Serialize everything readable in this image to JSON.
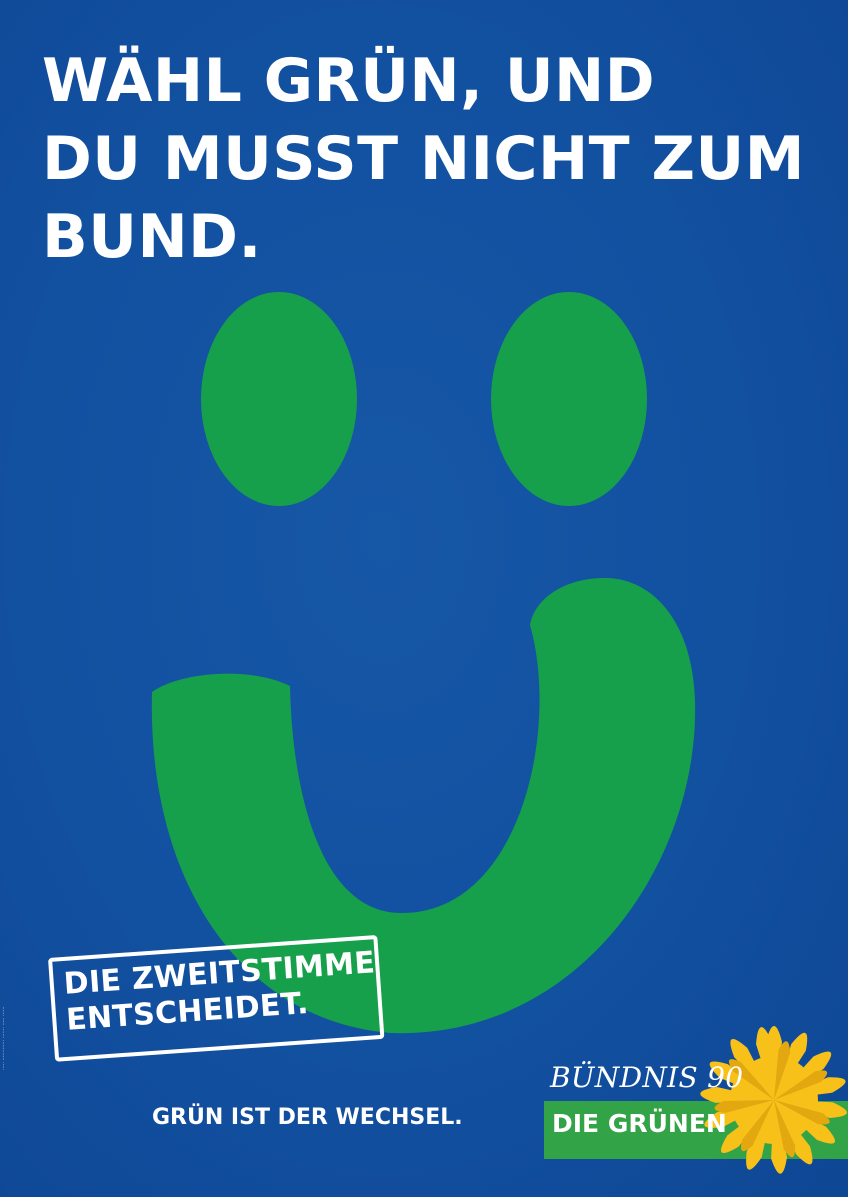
{
  "headline": {
    "line1": "WÄHL GRÜN, UND",
    "line2": "DU MUSST NICHT ZUM",
    "line3": "BUND."
  },
  "stamp": {
    "line1": "DIE ZWEITSTIMME",
    "line2": "ENTSCHEIDET."
  },
  "slogan": "GRÜN IST DER WECHSEL.",
  "logo": {
    "line1": "BÜNDNIS 90",
    "line2": "DIE GRÜNEN",
    "icon": "sunflower-icon"
  },
  "colors": {
    "background": "#1250a0",
    "smiley_green": "#16a04b",
    "logo_green": "#33a348",
    "sunflower_yellow": "#f7c11a",
    "text": "#ffffff"
  }
}
